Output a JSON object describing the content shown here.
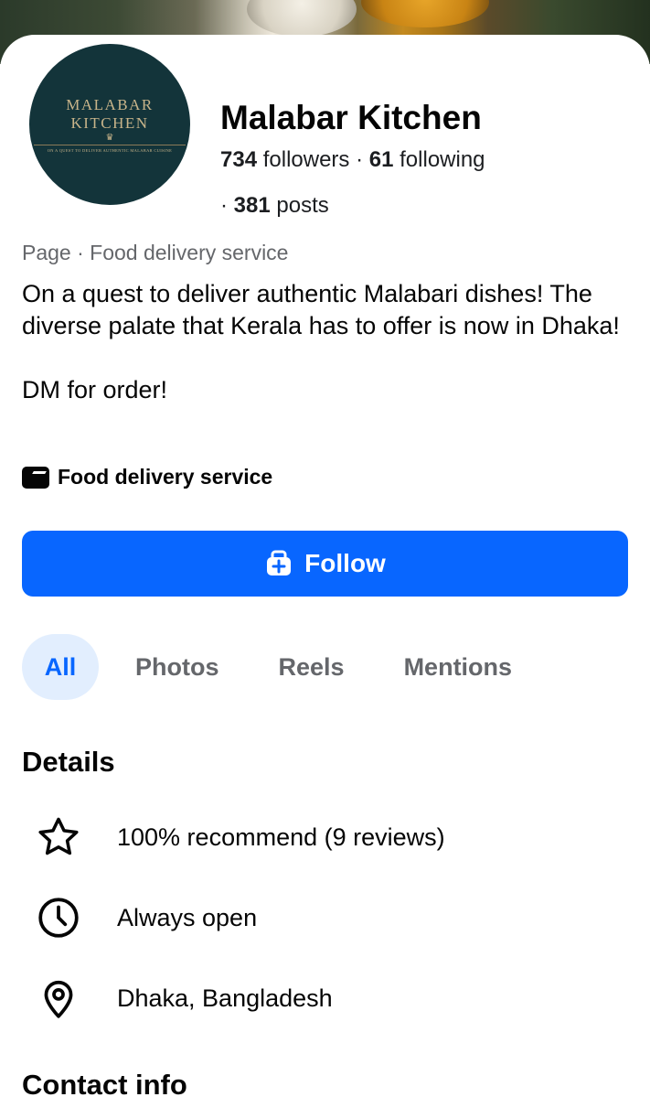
{
  "profile": {
    "logo_line1": "MALABAR",
    "logo_line2": "KITCHEN",
    "logo_tagline": "ON A QUEST TO DELIVER AUTHENTIC MALABAR CUISINE",
    "name": "Malabar Kitchen",
    "followers_count": "734",
    "followers_label": "followers",
    "following_count": "61",
    "following_label": "following",
    "posts_count": "381",
    "posts_label": "posts",
    "separator": "·"
  },
  "about": {
    "category_line": "Page · Food delivery service",
    "bio_line1": "On a quest to deliver authentic Malabari dishes! The diverse palate that Kerala has to offer is now in Dhaka!",
    "bio_line2": "DM for order!",
    "category_chip": "Food delivery service",
    "category_chip_icon": "category-icon"
  },
  "actions": {
    "follow_label": "Follow",
    "follow_icon": "follow-icon",
    "accent_color": "#0866ff"
  },
  "tabs": [
    {
      "label": "All",
      "active": true
    },
    {
      "label": "Photos",
      "active": false
    },
    {
      "label": "Reels",
      "active": false
    },
    {
      "label": "Mentions",
      "active": false
    }
  ],
  "details": {
    "title": "Details",
    "items": [
      {
        "icon": "star-icon",
        "text": "100% recommend (9 reviews)"
      },
      {
        "icon": "clock-icon",
        "text": "Always open"
      },
      {
        "icon": "location-pin-icon",
        "text": "Dhaka, Bangladesh"
      }
    ]
  },
  "contact": {
    "title": "Contact info"
  }
}
